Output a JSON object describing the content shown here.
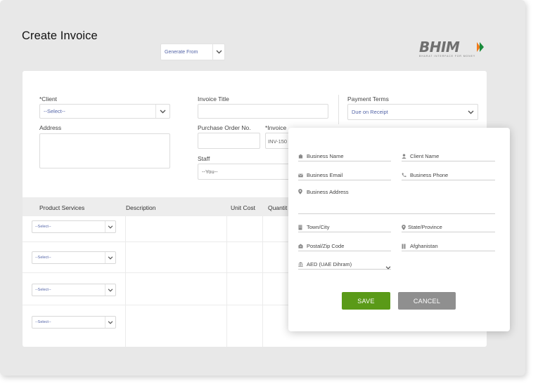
{
  "page": {
    "title": "Create Invoice"
  },
  "generate_from": {
    "value": "Generate From"
  },
  "logo": {
    "name": "BHIM",
    "tagline": "BHARAT INTERFACE FOR MONEY"
  },
  "form": {
    "client_label": "*Client",
    "client_value": "--Select--",
    "address_label": "Address",
    "invoice_title_label": "Invoice Title",
    "po_label": "Purchase Order No.",
    "invoice_no_label": "*Invoice",
    "invoice_no_value": "INV-150",
    "staff_label": "Staff",
    "staff_value": "--You--",
    "payment_terms_label": "Payment Terms",
    "payment_terms_value": "Due on Receipt"
  },
  "table": {
    "headers": [
      "Product Services",
      "Description",
      "Unit Cost",
      "Quantit"
    ],
    "rows": [
      {
        "product": "--Select--"
      },
      {
        "product": "--Select--"
      },
      {
        "product": "--Select--"
      },
      {
        "product": "--Select--"
      }
    ]
  },
  "modal": {
    "business_name": "Business Name",
    "client_name": "Client Name",
    "business_email": "Business Email",
    "business_phone": "Business Phone",
    "business_address": "Business Address",
    "town_city": "Town/City",
    "state_province": "State/Province",
    "postal_zip": "Postal/Zip Code",
    "country": "Afghanistan",
    "currency": "AED (UAE Dihram)",
    "save_label": "SAVE",
    "cancel_label": "CANCEL"
  },
  "colors": {
    "save": "#5a9a18",
    "cancel": "#8f8f8f",
    "select_text": "#5566a8",
    "background": "#e8e8e8"
  },
  "icons": [
    "chevron-down-icon",
    "building-icon",
    "user-icon",
    "email-icon",
    "phone-icon",
    "location-pin-icon",
    "city-icon",
    "postal-icon",
    "flag-icon",
    "bank-icon"
  ]
}
